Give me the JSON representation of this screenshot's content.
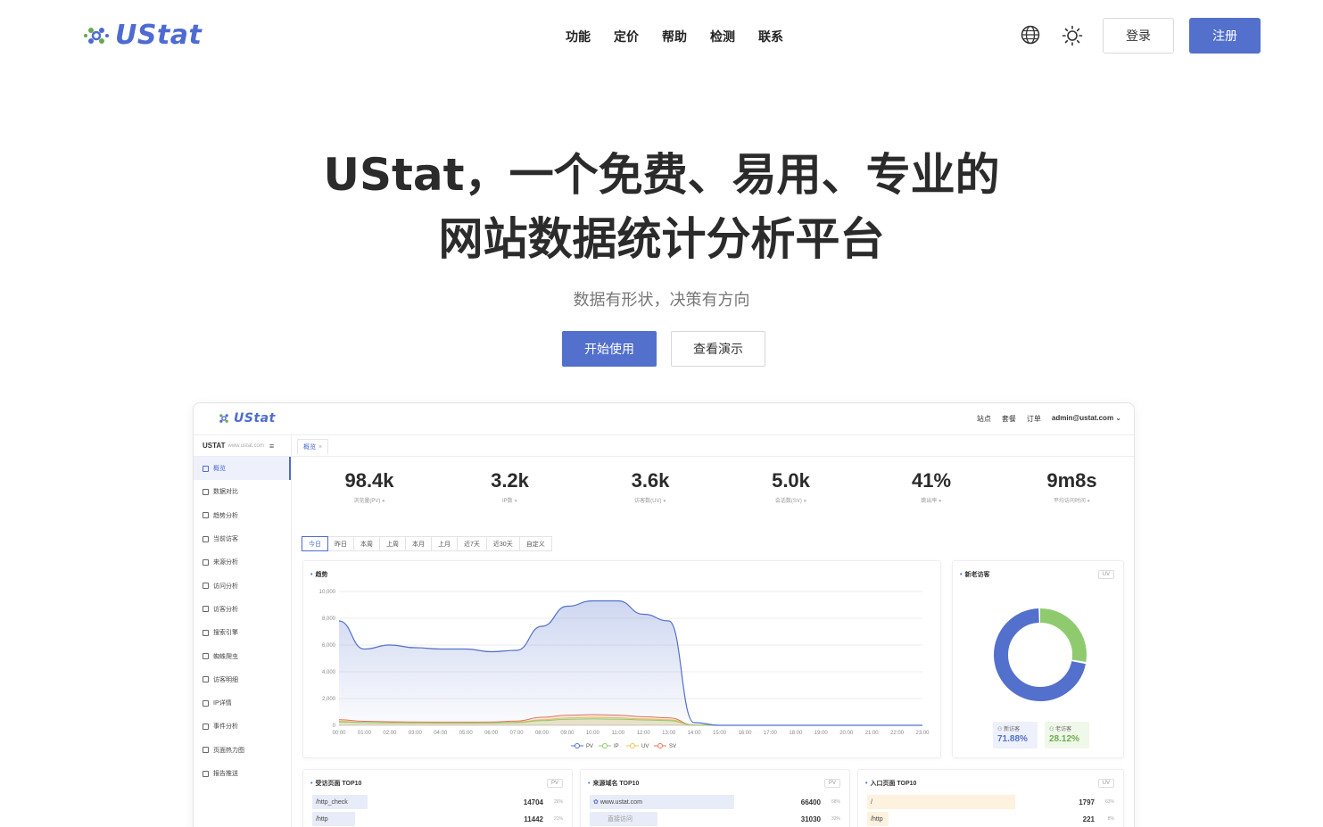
{
  "brand": {
    "name": "UStat",
    "color": "#4d6bd1"
  },
  "nav": {
    "links": [
      "功能",
      "定价",
      "帮助",
      "检测",
      "联系"
    ],
    "login_label": "登录",
    "register_label": "注册"
  },
  "hero": {
    "title_line1": "UStat，一个免费、易用、专业的",
    "title_line2": "网站数据统计分析平台",
    "subtitle": "数据有形状，决策有方向",
    "start_label": "开始使用",
    "demo_label": "查看演示"
  },
  "dashboard": {
    "topbar": {
      "links": [
        "站点",
        "套餐",
        "订单"
      ],
      "user": "admin@ustat.com"
    },
    "site": {
      "name": "USTAT",
      "domain": "www.ustat.com"
    },
    "sidebar": [
      "概览",
      "数据对比",
      "趋势分析",
      "当前访客",
      "来源分析",
      "访问分析",
      "访客分析",
      "搜索引擎",
      "蜘蛛爬虫",
      "访客明细",
      "IP详情",
      "事件分析",
      "页面热力图",
      "报告推送"
    ],
    "tab_label": "概览",
    "kpis": [
      {
        "value": "98.4k",
        "label": "浏览量(PV)"
      },
      {
        "value": "3.2k",
        "label": "IP数"
      },
      {
        "value": "3.6k",
        "label": "访客数(UV)"
      },
      {
        "value": "5.0k",
        "label": "会话数(SV)"
      },
      {
        "value": "41%",
        "label": "跳出率"
      },
      {
        "value": "9m8s",
        "label": "平均访问时间"
      }
    ],
    "periods": [
      "今日",
      "昨日",
      "本周",
      "上周",
      "本月",
      "上月",
      "近7天",
      "近30天",
      "自定义"
    ],
    "trend_title": "趋势",
    "donut": {
      "title": "新老访客",
      "badge": "UV",
      "new_label": "新访客",
      "new_pct": "71.88%",
      "old_label": "老访客",
      "old_pct": "28.12%",
      "new_color": "#5270cc",
      "old_color": "#8fcb6e"
    },
    "top_pages": {
      "title": "受访页面 TOP10",
      "badge": "PV",
      "rows": [
        {
          "label": "/http_check",
          "value": "14704",
          "pct": "26%"
        },
        {
          "label": "/http",
          "value": "11442",
          "pct": "21%"
        }
      ]
    },
    "top_domains": {
      "title": "来源域名 TOP10",
      "badge": "PV",
      "rows": [
        {
          "label": "www.ustat.com",
          "value": "66400",
          "pct": "68%"
        },
        {
          "label": "直接访问",
          "value": "31030",
          "pct": "32%"
        }
      ]
    },
    "top_entries": {
      "title": "入口页面 TOP10",
      "badge": "UV",
      "rows": [
        {
          "label": "/",
          "value": "1797",
          "pct": "63%"
        },
        {
          "label": "/http",
          "value": "221",
          "pct": "8%"
        }
      ]
    }
  },
  "chart_data": {
    "type": "area",
    "title": "趋势",
    "x": [
      "00:00",
      "01:00",
      "02:00",
      "03:00",
      "04:00",
      "05:00",
      "06:00",
      "07:00",
      "08:00",
      "09:00",
      "10:00",
      "11:00",
      "12:00",
      "13:00",
      "14:00",
      "15:00",
      "16:00",
      "17:00",
      "18:00",
      "19:00",
      "20:00",
      "21:00",
      "22:00",
      "23:00"
    ],
    "ylim": [
      0,
      10000
    ],
    "yticks": [
      "10,000",
      "8,000",
      "6,000",
      "4,000",
      "2,000",
      "0"
    ],
    "series": [
      {
        "name": "PV",
        "color": "#5270cc",
        "values": [
          7800,
          5700,
          6000,
          5800,
          5700,
          5700,
          5500,
          5600,
          7400,
          8900,
          9300,
          9300,
          8300,
          7800,
          200,
          0,
          0,
          0,
          0,
          0,
          0,
          0,
          0,
          0
        ]
      },
      {
        "name": "IP",
        "color": "#8fcb6e",
        "values": [
          250,
          200,
          180,
          170,
          160,
          160,
          170,
          200,
          350,
          450,
          480,
          460,
          400,
          350,
          10,
          0,
          0,
          0,
          0,
          0,
          0,
          0,
          0,
          0
        ]
      },
      {
        "name": "UV",
        "color": "#f2c14e",
        "values": [
          300,
          220,
          200,
          190,
          180,
          180,
          190,
          230,
          420,
          550,
          600,
          560,
          480,
          420,
          15,
          0,
          0,
          0,
          0,
          0,
          0,
          0,
          0,
          0
        ]
      },
      {
        "name": "SV",
        "color": "#e5735a",
        "values": [
          420,
          300,
          270,
          250,
          240,
          240,
          250,
          320,
          600,
          750,
          800,
          760,
          640,
          560,
          20,
          0,
          0,
          0,
          0,
          0,
          0,
          0,
          0,
          0
        ]
      }
    ],
    "legend": "bottom",
    "grid": true
  }
}
